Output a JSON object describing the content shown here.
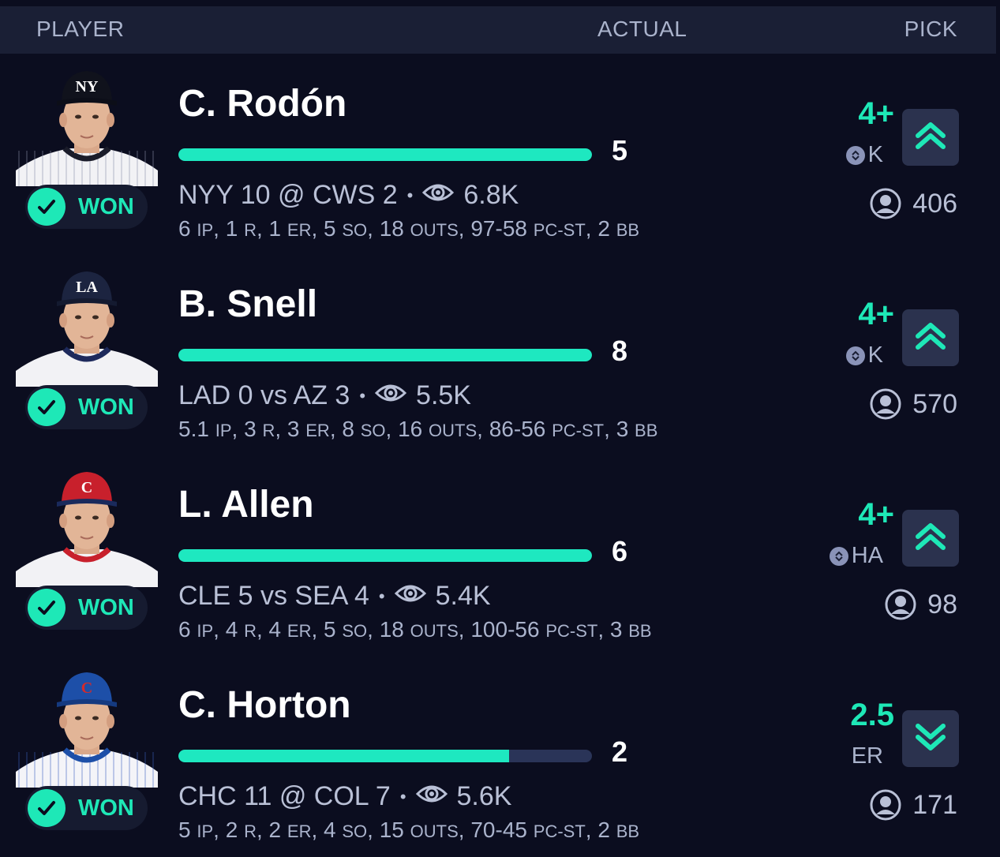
{
  "header": {
    "player": "PLAYER",
    "actual": "ACTUAL",
    "pick": "PICK"
  },
  "colors": {
    "accent": "#1ee8b7",
    "background": "#0b0d1f",
    "header_bg": "#1a1f35",
    "bar_track": "#2a3458"
  },
  "rows": [
    {
      "name": "C. Rodón",
      "result": "WON",
      "actual": "5",
      "progress": 1.0,
      "game": "NYY 10 @ CWS 2",
      "views": "6.8K",
      "stats": [
        {
          "v": "6",
          "u": "IP"
        },
        {
          "v": "1",
          "u": "R"
        },
        {
          "v": "1",
          "u": "ER"
        },
        {
          "v": "5",
          "u": "SO"
        },
        {
          "v": "18",
          "u": "OUTS"
        },
        {
          "v": "97-58",
          "u": "PC-ST"
        },
        {
          "v": "2",
          "u": "BB"
        }
      ],
      "line": "4+",
      "stat_label": "K",
      "direction": "up",
      "pickers": "406",
      "cap": "navy-ny",
      "jersey": "pinstripe"
    },
    {
      "name": "B. Snell",
      "result": "WON",
      "actual": "8",
      "progress": 1.0,
      "game": "LAD 0 vs AZ 3",
      "views": "5.5K",
      "stats": [
        {
          "v": "5.1",
          "u": "IP"
        },
        {
          "v": "3",
          "u": "R"
        },
        {
          "v": "3",
          "u": "ER"
        },
        {
          "v": "8",
          "u": "SO"
        },
        {
          "v": "16",
          "u": "OUTS"
        },
        {
          "v": "86-56",
          "u": "PC-ST"
        },
        {
          "v": "3",
          "u": "BB"
        }
      ],
      "line": "4+",
      "stat_label": "K",
      "direction": "up",
      "pickers": "570",
      "cap": "navy-la",
      "jersey": "white"
    },
    {
      "name": "L. Allen",
      "result": "WON",
      "actual": "6",
      "progress": 1.0,
      "game": "CLE 5 vs SEA 4",
      "views": "5.4K",
      "stats": [
        {
          "v": "6",
          "u": "IP"
        },
        {
          "v": "4",
          "u": "R"
        },
        {
          "v": "4",
          "u": "ER"
        },
        {
          "v": "5",
          "u": "SO"
        },
        {
          "v": "18",
          "u": "OUTS"
        },
        {
          "v": "100-56",
          "u": "PC-ST"
        },
        {
          "v": "3",
          "u": "BB"
        }
      ],
      "line": "4+",
      "stat_label": "HA",
      "direction": "up",
      "pickers": "98",
      "cap": "red-c",
      "jersey": "white-red"
    },
    {
      "name": "C. Horton",
      "result": "WON",
      "actual": "2",
      "progress": 0.8,
      "game": "CHC 11 @ COL 7",
      "views": "5.6K",
      "stats": [
        {
          "v": "5",
          "u": "IP"
        },
        {
          "v": "2",
          "u": "R"
        },
        {
          "v": "2",
          "u": "ER"
        },
        {
          "v": "4",
          "u": "SO"
        },
        {
          "v": "15",
          "u": "OUTS"
        },
        {
          "v": "70-45",
          "u": "PC-ST"
        },
        {
          "v": "2",
          "u": "BB"
        }
      ],
      "line": "2.5",
      "stat_label": "ER",
      "direction": "down",
      "pickers": "171",
      "cap": "blue-c",
      "jersey": "blue-pin"
    }
  ]
}
